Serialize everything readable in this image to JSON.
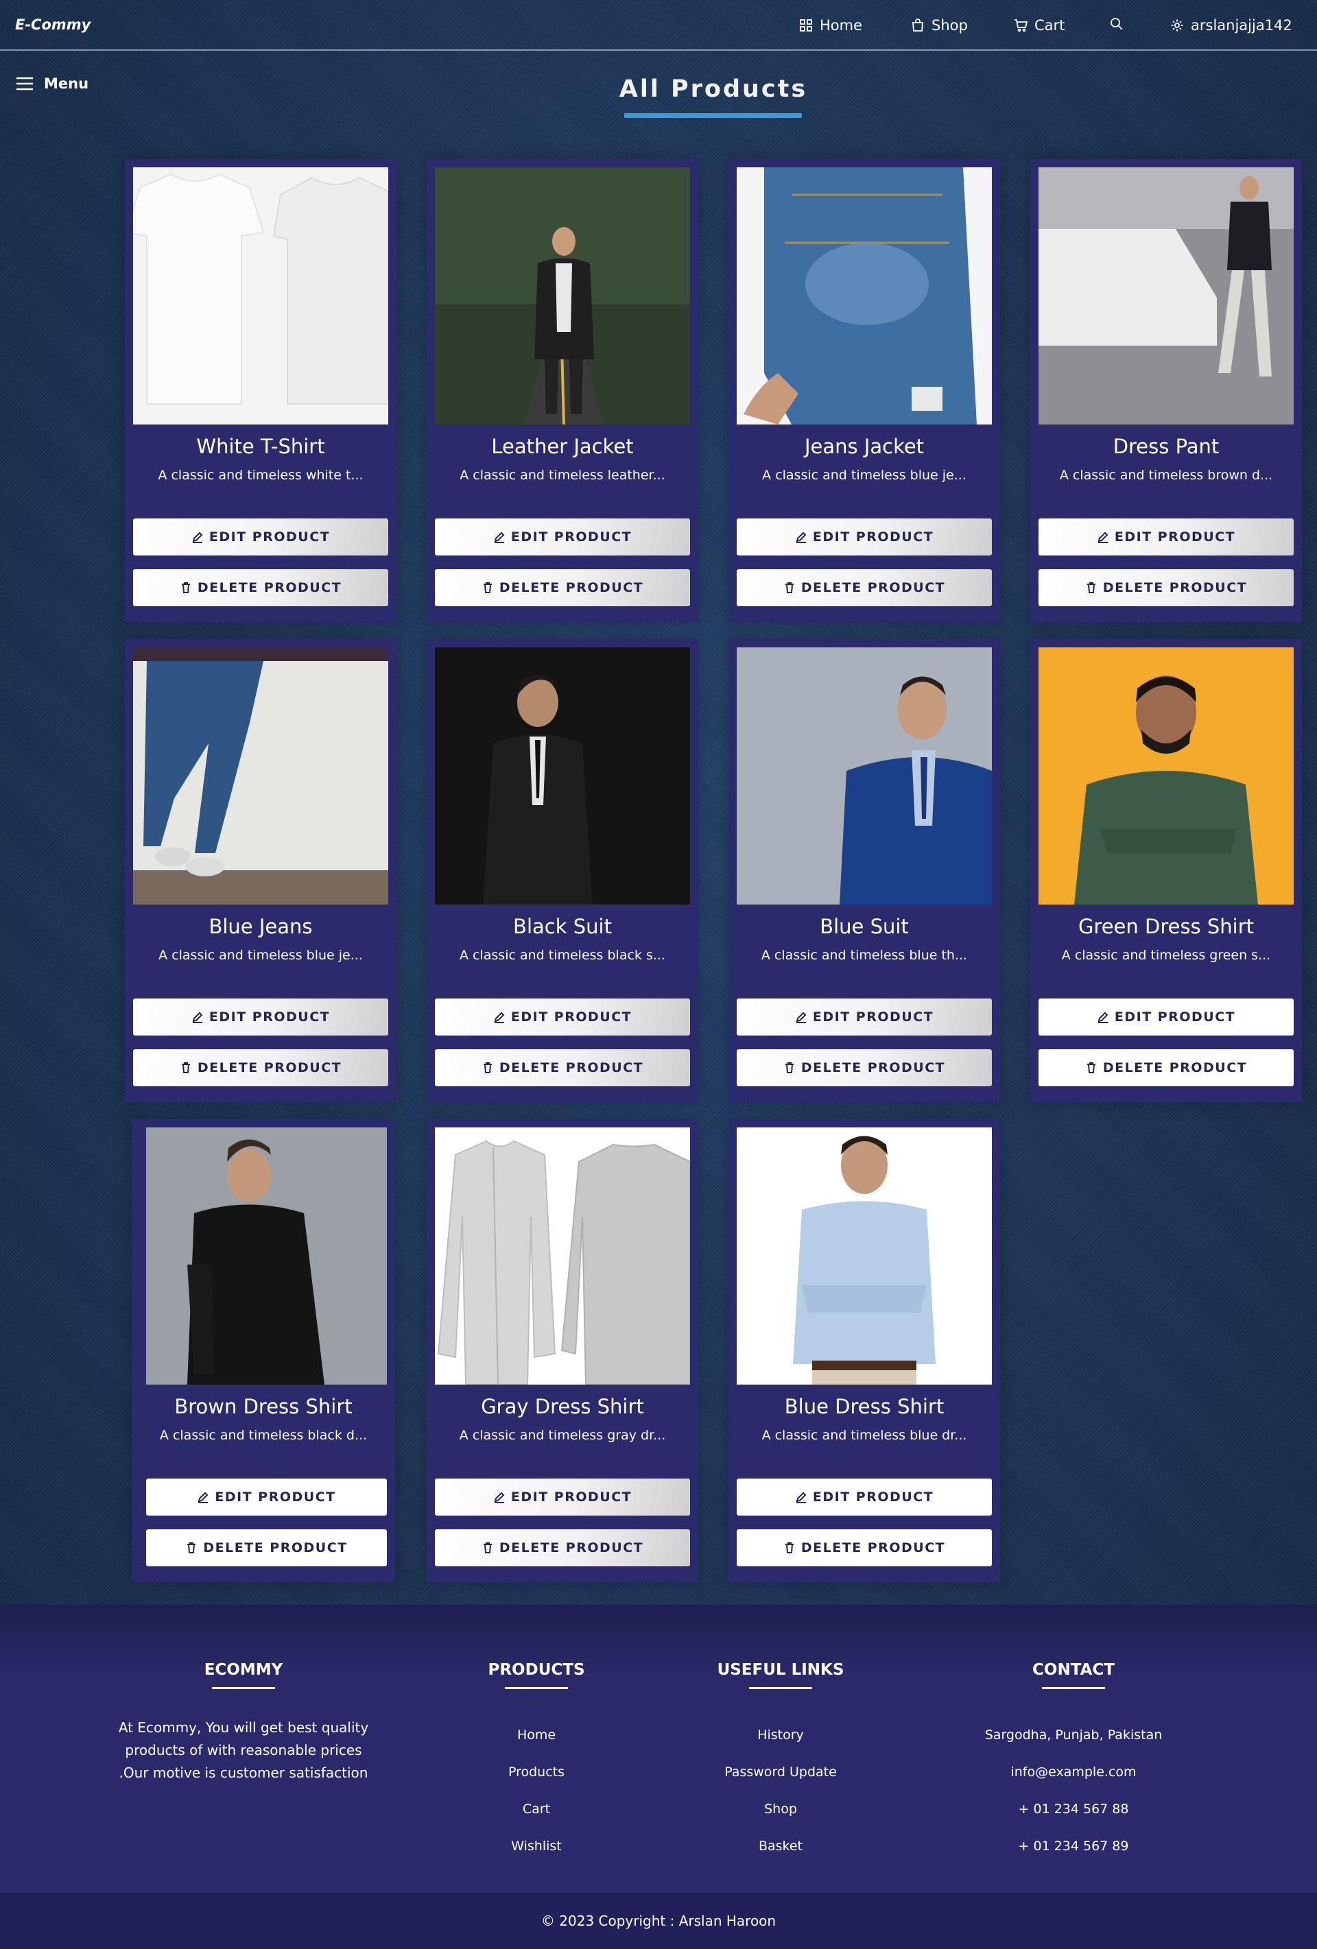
{
  "navbar": {
    "brand": "E-Commy",
    "home": "Home",
    "shop": "Shop",
    "cart": "Cart",
    "user": "arslanjajja142"
  },
  "menu": {
    "label": "Menu"
  },
  "page": {
    "title": "All Products"
  },
  "buttons": {
    "edit": "EDIT PRODUCT",
    "delete": "DELETE PRODUCT"
  },
  "products": [
    {
      "name": "White T-Shirt",
      "desc": "A classic and timeless white t..."
    },
    {
      "name": "Leather Jacket",
      "desc": "A classic and timeless leather..."
    },
    {
      "name": "Jeans Jacket",
      "desc": "A classic and timeless blue je..."
    },
    {
      "name": "Dress Pant",
      "desc": "A classic and timeless brown d..."
    },
    {
      "name": "Blue Jeans",
      "desc": "A classic and timeless blue je..."
    },
    {
      "name": "Black Suit",
      "desc": "A classic and timeless black s..."
    },
    {
      "name": "Blue Suit",
      "desc": "A classic and timeless blue th..."
    },
    {
      "name": "Green Dress Shirt",
      "desc": "A classic and timeless green s..."
    },
    {
      "name": "Brown Dress Shirt",
      "desc": "A classic and timeless black d..."
    },
    {
      "name": "Gray Dress Shirt",
      "desc": "A classic and timeless gray dr..."
    },
    {
      "name": "Blue Dress Shirt",
      "desc": "A classic and timeless blue dr..."
    }
  ],
  "footer": {
    "ecommy": {
      "heading": "ECOMMY",
      "text": "At Ecommy, You will get best quality products of with reasonable prices .Our motive is customer satisfaction"
    },
    "products": {
      "heading": "PRODUCTS",
      "links": [
        "Home",
        "Products",
        "Cart",
        "Wishlist"
      ]
    },
    "useful_links": {
      "heading": "USEFUL LINKS",
      "links": [
        "History",
        "Password Update",
        "Shop",
        "Basket"
      ]
    },
    "contact": {
      "heading": "CONTACT",
      "items": [
        "Sargodha, Punjab, Pakistan",
        "info@example.com",
        "+ 01 234 567 88",
        "+ 01 234 567 89"
      ]
    },
    "copyright": "© 2023 Copyright : Arslan Haroon"
  },
  "icons": {
    "home": "grid-icon",
    "shop": "bag-icon",
    "cart": "cart-icon",
    "search": "search-icon",
    "settings": "gear-icon",
    "menu": "hamburger-icon",
    "edit": "pencil-icon",
    "delete": "trash-icon"
  },
  "colors": {
    "card_bg": "#2b2a6d",
    "title_underline": "#3a9bdc",
    "button_text": "#25254f",
    "footer_bg": "#2b2a6d"
  }
}
